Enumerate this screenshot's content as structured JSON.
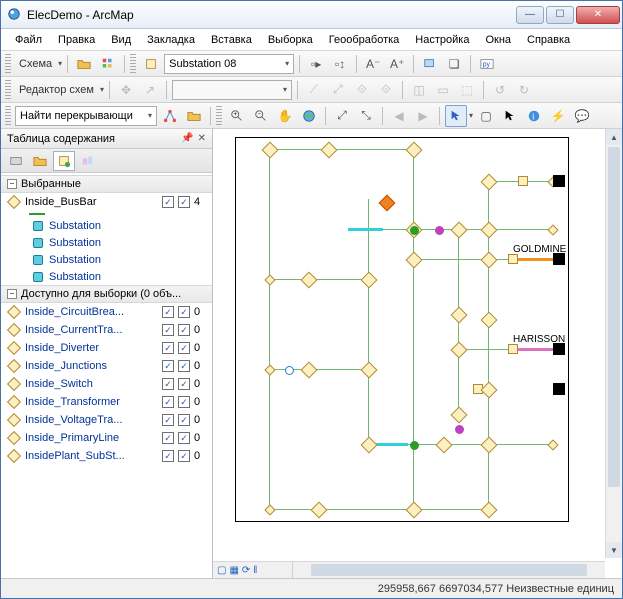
{
  "window": {
    "title": "ElecDemo - ArcMap"
  },
  "winbtns": {
    "min": "—",
    "max": "☐",
    "close": "✕"
  },
  "menu": [
    "Файл",
    "Правка",
    "Вид",
    "Закладка",
    "Вставка",
    "Выборка",
    "Геообработка",
    "Настройка",
    "Окна",
    "Справка"
  ],
  "toolbar1": {
    "schema_label": "Схема",
    "combo_value": "Substation 08"
  },
  "toolbar2": {
    "editor_label": "Редактор схем"
  },
  "toolbar3": {
    "find_label": "Найти перекрывающи"
  },
  "toc": {
    "header": "Таблица содержания",
    "selected_group": "Выбранные",
    "available_group": "Доступно для выборки (0 объ...",
    "busbar": {
      "name": "Inside_BusBar",
      "count": "4"
    },
    "sub_items": [
      "Substation",
      "Substation",
      "Substation",
      "Substation"
    ],
    "layers": [
      {
        "name": "Inside_CircuitBrea...",
        "count": "0"
      },
      {
        "name": "Inside_CurrentTra...",
        "count": "0"
      },
      {
        "name": "Inside_Diverter",
        "count": "0"
      },
      {
        "name": "Inside_Junctions",
        "count": "0"
      },
      {
        "name": "Inside_Switch",
        "count": "0"
      },
      {
        "name": "Inside_Transformer",
        "count": "0"
      },
      {
        "name": "Inside_VoltageTra...",
        "count": "0"
      },
      {
        "name": "Inside_PrimaryLine",
        "count": "0"
      },
      {
        "name": "InsidePlant_SubSt...",
        "count": "0"
      }
    ]
  },
  "map": {
    "labels": {
      "goldmine": "GOLDMINE",
      "harisson": "HARISSON"
    }
  },
  "status": {
    "coords": "295958,667  6697034,577  Неизвестные единиц"
  }
}
